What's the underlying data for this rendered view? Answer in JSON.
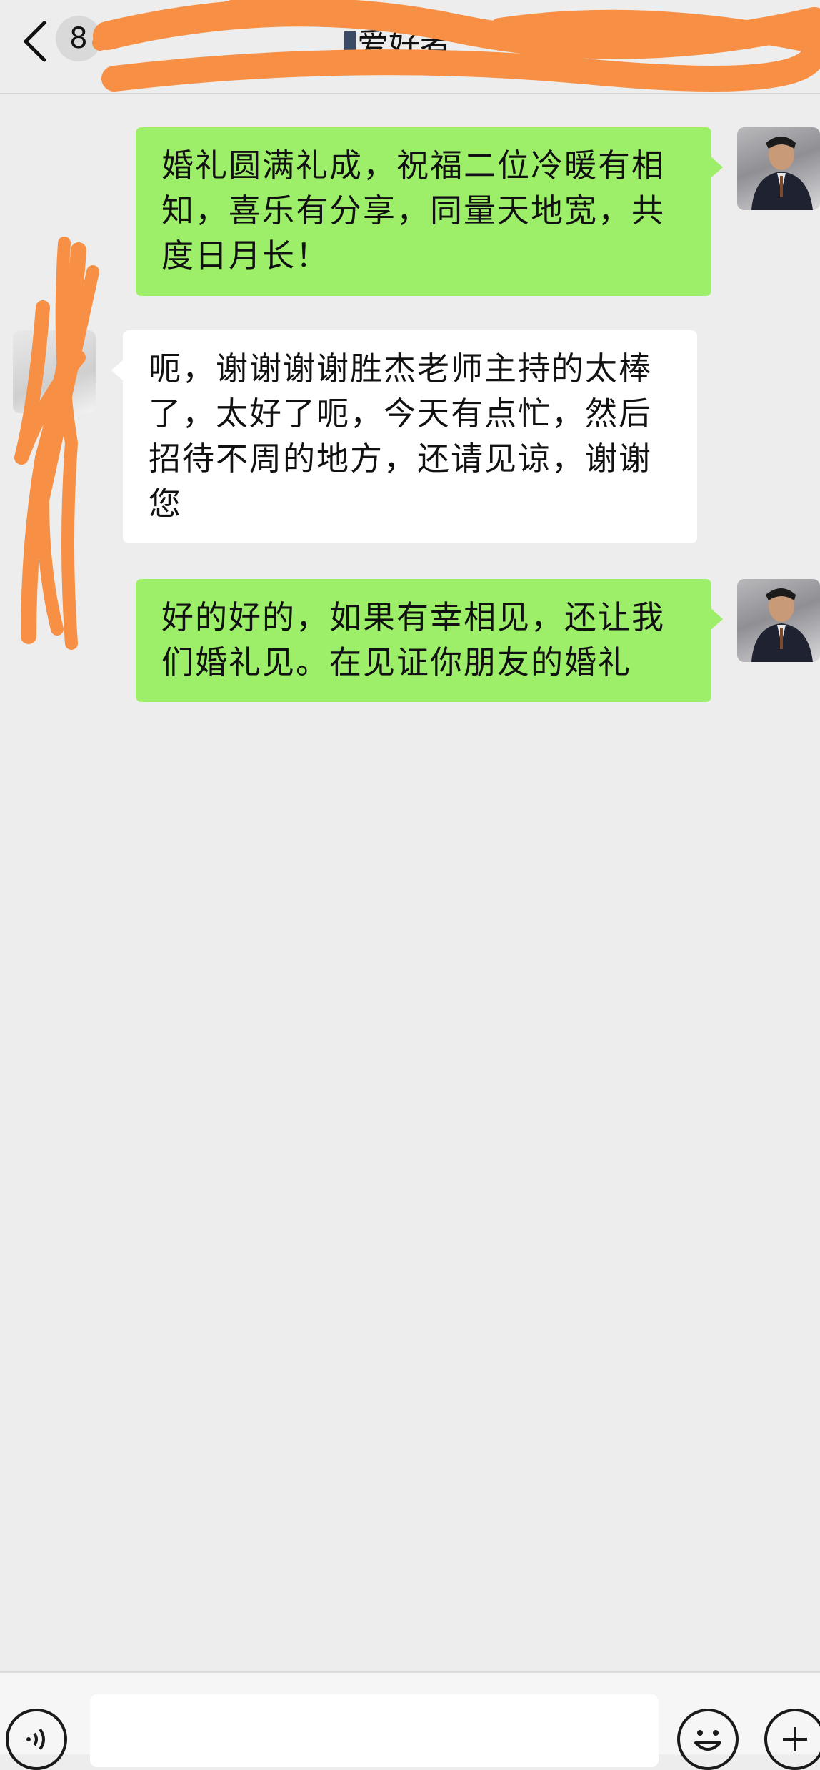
{
  "header": {
    "unread_count": "8",
    "title": "爱好者"
  },
  "messages": [
    {
      "sender": "me",
      "text": "婚礼圆满礼成，祝福二位冷暖有相知，喜乐有分享，同量天地宽，共度日月长！"
    },
    {
      "sender": "other",
      "text": "呃，谢谢谢谢胜杰老师主持的太棒了，太好了呃，今天有点忙，然后招待不周的地方，还请见谅，谢谢您"
    },
    {
      "sender": "me",
      "text": "好的好的，如果有幸相见，还让我们婚礼见。在见证你朋友的婚礼"
    }
  ],
  "input_bar": {
    "voice_icon": "voice-icon",
    "emoji_icon": "emoji-icon",
    "plus_icon": "plus-icon",
    "message_value": ""
  },
  "colors": {
    "background": "#ededed",
    "my_bubble": "#9def6a",
    "other_bubble": "#ffffff",
    "redaction": "#f78f45"
  }
}
